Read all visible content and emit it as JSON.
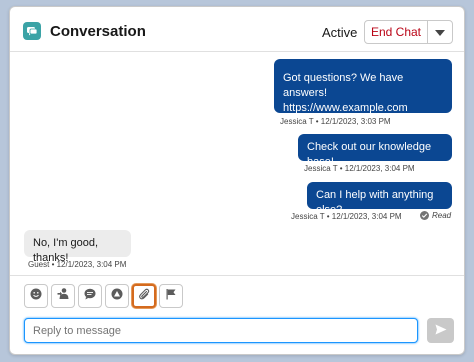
{
  "header": {
    "title": "Conversation",
    "status": "Active",
    "end_chat_label": "End Chat",
    "app_icon": "chat-icon",
    "menu_icon": "chevron-down-icon"
  },
  "messages": [
    {
      "sender": "agent",
      "lines": [
        "Got questions? We have answers!",
        "https://www.example.com"
      ],
      "meta": "Jessica T • 12/1/2023, 3:03 PM"
    },
    {
      "sender": "agent",
      "lines": [
        "Check out our knowledge base!"
      ],
      "meta": "Jessica T • 12/1/2023, 3:04 PM"
    },
    {
      "sender": "agent",
      "lines": [
        "Can I help with anything else?"
      ],
      "meta": "Jessica T • 12/1/2023, 3:04 PM",
      "read_label": "Read"
    },
    {
      "sender": "guest",
      "lines": [
        "No, I'm good, thanks!"
      ],
      "meta": "Guest • 12/1/2023, 3:04 PM"
    }
  ],
  "toolbar": {
    "tools": [
      "emoji-icon",
      "agent-icon",
      "quick-text-icon",
      "knowledge-icon",
      "attachment-icon",
      "flag-icon"
    ],
    "active_tool": "attachment-icon"
  },
  "composer": {
    "placeholder": "Reply to message",
    "send_icon": "send-icon"
  },
  "colors": {
    "agent_bubble": "#0b4792",
    "guest_bubble": "#ececec",
    "end_chat_text": "#ba0517",
    "app_icon_bg": "#3ba3a6",
    "focus": "#1b96ff"
  }
}
